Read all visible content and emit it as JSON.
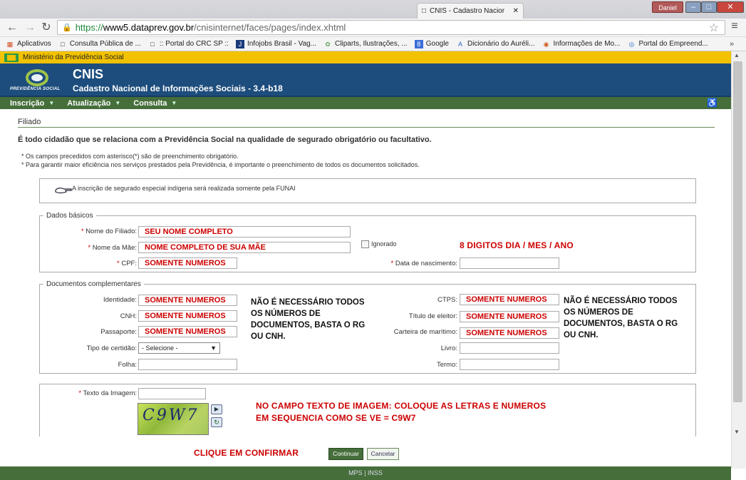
{
  "browser": {
    "tab_title": "CNIS - Cadastro Nacior",
    "user": "Daniel",
    "url_https": "https://",
    "url_domain": "www5.dataprev.gov.br",
    "url_path": "/cnisinternet/faces/pages/index.xhtml",
    "bookmarks": [
      {
        "label": "Aplicativos",
        "icon": "apps-grid-icon"
      },
      {
        "label": "Consulta Pública de ...",
        "icon": "page-icon"
      },
      {
        "label": ":: Portal do CRC SP ::",
        "icon": "page-icon"
      },
      {
        "label": "Infojobs Brasil - Vag...",
        "icon": "infojobs-icon"
      },
      {
        "label": "Cliparts, Ilustrações, ...",
        "icon": "clipart-icon"
      },
      {
        "label": "Google",
        "icon": "google-icon"
      },
      {
        "label": "Dicionário do Auréli...",
        "icon": "a-letter-icon"
      },
      {
        "label": "Informações de Mo...",
        "icon": "info-globe-icon"
      },
      {
        "label": "Portal do Empreend...",
        "icon": "portal-icon"
      }
    ]
  },
  "header": {
    "ministry": "Ministério da Previdência Social",
    "logo_text": "PREVIDÊNCIA SOCIAL",
    "app_title": "CNIS",
    "app_subtitle": "Cadastro Nacional de Informações Sociais - 3.4-b18"
  },
  "nav": {
    "items": [
      {
        "label": "Inscrição"
      },
      {
        "label": "Atualização"
      },
      {
        "label": "Consulta"
      }
    ]
  },
  "content": {
    "section_title": "Filiado",
    "intro": "É todo cidadão que se relaciona com a Previdência Social na qualidade de segurado obrigatório ou facultativo.",
    "note1": "* Os campos precedidos com asterisco(*) são de preenchimento obrigatório.",
    "note2": "* Para garantir maior eficiência nos serviços prestados pela Previdência, é importante o preenchimento de todos os documentos solicitados.",
    "info": "A inscrição de segurado especial indígena será realizada somente pela FUNAI"
  },
  "basic": {
    "legend": "Dados básicos",
    "nome_filiado_label": "Nome do Filiado:",
    "nome_filiado_value": "SEU NOME COMPLETO",
    "nome_mae_label": "Nome da Mãe:",
    "nome_mae_value": "NOME COMPLETO DE SUA MÃE",
    "ignorado_label": "Ignorado",
    "cpf_label": "CPF:",
    "cpf_value": "SOMENTE NUMEROS",
    "nascimento_label": "Data de nascimento:",
    "nascimento_value": "",
    "annotation_date": "8 DIGITOS DIA / MES / ANO"
  },
  "docs": {
    "legend": "Documentos complementares",
    "identidade_label": "Identidade:",
    "identidade_value": "SOMENTE NUMEROS",
    "cnh_label": "CNH:",
    "cnh_value": "SOMENTE NUMEROS",
    "passaporte_label": "Passaporte:",
    "passaporte_value": "SOMENTE NUMEROS",
    "certidao_label": "Tipo de certidão:",
    "certidao_selected": "- Selecione -",
    "folha_label": "Folha:",
    "folha_value": "",
    "ctps_label": "CTPS:",
    "ctps_value": "SOMENTE NUMEROS",
    "titulo_label": "Título de eleitor:",
    "titulo_value": "SOMENTE NUMEROS",
    "maritimo_label": "Carteira de marítimo:",
    "maritimo_value": "SOMENTE NUMEROS",
    "livro_label": "Livro:",
    "livro_value": "",
    "termo_label": "Termo:",
    "termo_value": "",
    "annotation_left": [
      "NÃO É NECESSÁRIO TODOS",
      "OS NÚMEROS DE",
      "DOCUMENTOS, BASTA O RG",
      "OU CNH."
    ],
    "annotation_right": [
      "NÃO É NECESSÁRIO TODOS",
      "OS NÚMEROS DE",
      "DOCUMENTOS, BASTA O RG",
      "OU CNH."
    ]
  },
  "captcha": {
    "label": "Texto da Imagem:",
    "value": "",
    "image_text": "C9W7",
    "annotation_line1": "NO CAMPO TEXTO DE IMAGEM: COLOQUE AS LETRAS E NUMEROS",
    "annotation_line2": "EM SEQUENCIA COMO SE VE = C9W7"
  },
  "actions": {
    "annotation": "CLIQUE EM CONFIRMAR",
    "confirm_label": "Continuar",
    "cancel_label": "Cancelar"
  },
  "footer": {
    "text": "MPS | INSS"
  },
  "colors": {
    "banner": "#1d4d7c",
    "nav": "#456e3a",
    "ministry_bar": "#f2c200",
    "annotation": "#cc0000"
  }
}
